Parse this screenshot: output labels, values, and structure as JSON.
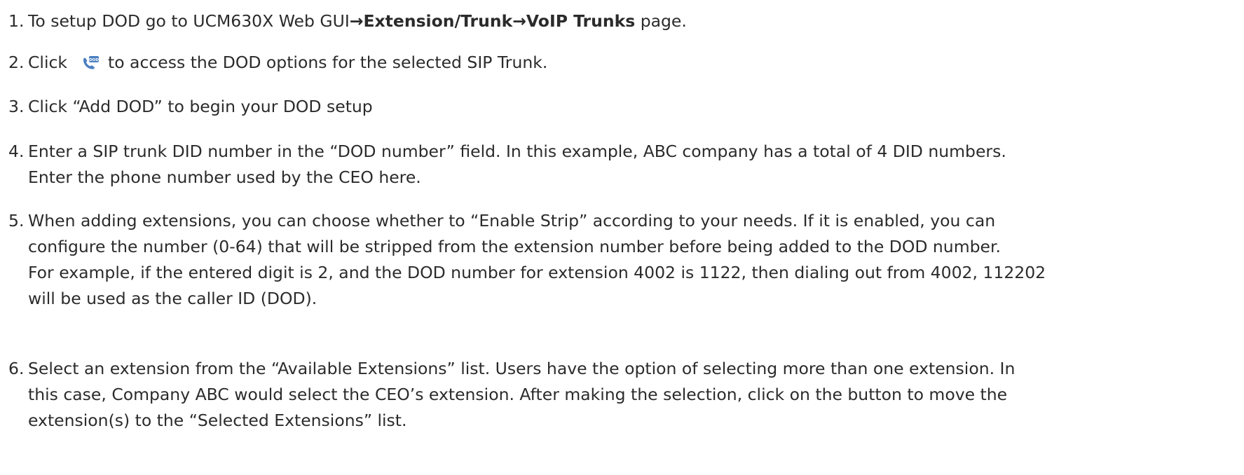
{
  "steps": [
    {
      "num": "1.",
      "pre": "To setup DOD go to UCM630X Web GUI",
      "arrow1": "→",
      "bold1": "Extension/Trunk",
      "arrow2": "→",
      "bold2": "VoIP Trunks",
      "post": " page."
    },
    {
      "num": "2.",
      "pre": "Click",
      "icon": "dod-phone-icon",
      "icon_text": "DOD",
      "post": "to access the DOD options for the selected SIP Trunk."
    },
    {
      "num": "3.",
      "lines": [
        "Click “Add DOD” to begin your DOD setup"
      ]
    },
    {
      "num": "4.",
      "lines": [
        "Enter a SIP trunk DID number in the “DOD number” field. In this example, ABC company has a total of 4 DID numbers.",
        "Enter the phone number used by the CEO here."
      ]
    },
    {
      "num": "5.",
      "lines": [
        "When adding extensions, you can choose whether to “Enable Strip” according to your needs. If it is enabled, you can",
        "configure the number (0-64) that will be stripped from the extension number before being added to the DOD number.",
        "For example, if the entered digit is 2, and the DOD number for extension 4002 is 1122, then dialing out from 4002, 112202",
        "will be used as the caller ID (DOD)."
      ]
    },
    {
      "num": "6.",
      "lines": [
        "Select an extension from the “Available Extensions” list. Users have the option of selecting more than one extension. In",
        "this case, Company ABC would select the CEO’s extension. After making the selection, click on the button to move the",
        "extension(s) to the “Selected Extensions” list."
      ]
    }
  ],
  "colors": {
    "text": "#2b2b2b",
    "icon": "#4a7fc1"
  }
}
